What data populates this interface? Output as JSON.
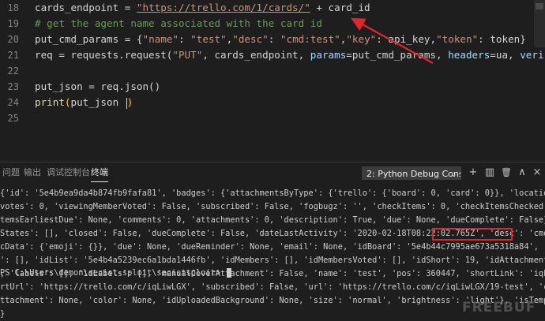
{
  "editor": {
    "lines": [
      {
        "num": "18",
        "tokens": [
          {
            "t": "cards_endpoint = ",
            "c": "plain"
          },
          {
            "t": "\"https://trello.com/1/cards/\"",
            "c": "url"
          },
          {
            "t": " + card_id",
            "c": "plain"
          }
        ]
      },
      {
        "num": "19",
        "tokens": [
          {
            "t": "# get the agent name associated with the card id",
            "c": "cmt"
          }
        ]
      },
      {
        "num": "20",
        "tokens": [
          {
            "t": "put_cmd_params = {",
            "c": "plain"
          },
          {
            "t": "\"name\"",
            "c": "str"
          },
          {
            "t": ": ",
            "c": "plain"
          },
          {
            "t": "\"test\"",
            "c": "str"
          },
          {
            "t": ",",
            "c": "plain"
          },
          {
            "t": "\"desc\"",
            "c": "str"
          },
          {
            "t": ": ",
            "c": "plain"
          },
          {
            "t": "\"cmd:test\"",
            "c": "str"
          },
          {
            "t": ",",
            "c": "plain"
          },
          {
            "t": "\"key\"",
            "c": "str"
          },
          {
            "t": ": api_key,",
            "c": "plain"
          },
          {
            "t": "\"token\"",
            "c": "str"
          },
          {
            "t": ": token}",
            "c": "plain"
          }
        ]
      },
      {
        "num": "21",
        "tokens": [
          {
            "t": "req = requests.request(",
            "c": "plain"
          },
          {
            "t": "\"PUT\"",
            "c": "str"
          },
          {
            "t": ", cards_endpoint, ",
            "c": "plain"
          },
          {
            "t": "params",
            "c": "par"
          },
          {
            "t": "=put_cmd_params, ",
            "c": "plain"
          },
          {
            "t": "headers",
            "c": "par"
          },
          {
            "t": "=ua, ",
            "c": "plain"
          },
          {
            "t": "veri",
            "c": "par"
          }
        ]
      },
      {
        "num": "22",
        "tokens": []
      },
      {
        "num": "23",
        "tokens": [
          {
            "t": "put_json = req.json()",
            "c": "plain"
          }
        ]
      },
      {
        "num": "24",
        "tokens": [
          {
            "t": "print",
            "c": "fn"
          },
          {
            "t": "(",
            "c": "br"
          },
          {
            "t": "put_json ",
            "c": "plain"
          },
          {
            "t": ")",
            "c": "br"
          }
        ]
      },
      {
        "num": "25",
        "tokens": []
      }
    ]
  },
  "panel": {
    "tabs": [
      "问题",
      "输出",
      "调试控制台",
      "终端"
    ],
    "active_tab": "终端",
    "terminal_selector": "2: Python Debug Consc",
    "controls": {
      "add": "+",
      "split": "▥",
      "trash": "🗑",
      "collapse": "∧",
      "close": "×"
    }
  },
  "terminal": {
    "lines": [
      "{'id': '5e4b9ea9da4b874fb9fafa81', 'badges': {'attachmentsByType': {'trello': {'board': 0, 'card': 0}}, 'location': False, '",
      "votes': 0, 'viewingMemberVoted': False, 'subscribed': False, 'fogbugz': '', 'checkItems': 0, 'checkItemsChecked': 0, 'checkI",
      "temsEarliestDue': None, 'comments': 0, 'attachments': 0, 'description': True, 'due': None, 'dueComplete': False}, 'checkItem",
      "States': [], 'closed': False, 'dueComplete': False, 'dateLastActivity': '2020-02-18T08:22:02.765Z', 'desc': 'cmd:test', 'des",
      "cData': {'emoji': {}}, 'due': None, 'dueReminder': None, 'email': None, 'idBoard': '5e4b44c7995ae673a5318a84', 'idChecklists",
      "': [], 'idList': '5e4b4a5239ec6a1bda1446fb', 'idMembers': [], 'idMembersVoted': [], 'idShort': 19, 'idAttachmentCover': None",
      ", 'labels': [], 'idLabels': [], 'manualCoverAttachment': False, 'name': 'test', 'pos': 360447, 'shortLink': 'iqLiwLGX', 'sho",
      "rtUrl': 'https://trello.com/c/iqLiwLGX', 'subscribed': False, 'url': 'https://trello.com/c/iqLiwLGX/19-test', 'cover': {'idA",
      "ttachment': None, 'color': None, 'idUploadedBackground': None, 'size': 'normal', 'brightness': 'light'}, 'isTemplate': False",
      "}",
      "PS C:\\Users\\demon\\secist-sploit\\secistsploit> "
    ]
  },
  "watermark": "FREEBUF",
  "colors": {
    "background": "#1e1e1e",
    "string": "#ce9178",
    "comment": "#6a9955",
    "param": "#9cdcfe",
    "function": "#dcdcaa",
    "annotation": "#e0262c"
  }
}
